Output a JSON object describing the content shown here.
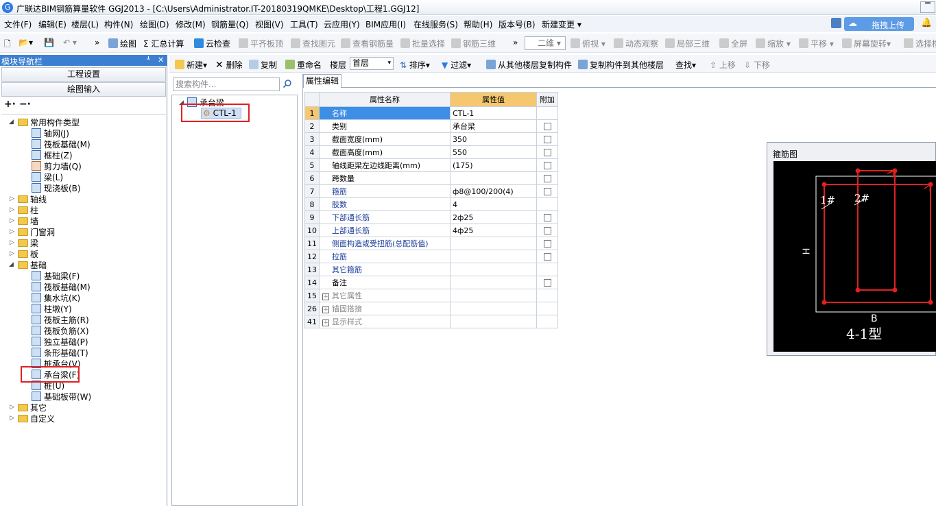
{
  "window": {
    "title": "广联达BIM钢筋算量软件 GGJ2013 - [C:\\Users\\Administrator.IT-20180319QMKE\\Desktop\\工程1.GGJ12]",
    "min": "▔",
    "close": "✕"
  },
  "menu": [
    "文件(F)",
    "编辑(E)",
    "楼层(L)",
    "构件(N)",
    "绘图(D)",
    "修改(M)",
    "钢筋量(Q)",
    "视图(V)",
    "工具(T)",
    "云应用(Y)",
    "BIM应用(I)",
    "在线服务(S)",
    "帮助(H)",
    "版本号(B)",
    "新建变更 ▾"
  ],
  "upload": {
    "label": "拖拽上传"
  },
  "toolbar": {
    "draw": "绘图",
    "sum": "Σ 汇总计算",
    "cloud_check": "云检查",
    "flat": "平齐板顶",
    "find_elem": "查找图元",
    "view_rebar": "查看钢筋量",
    "batch_select": "批量选择",
    "rebar3d": "钢筋三维",
    "dim": "二维",
    "top_view": "俯视",
    "dynamic": "动态观察",
    "local3d": "局部三维",
    "full": "全屏",
    "zoom": "缩放",
    "pan": "平移",
    "rotate": "屏幕旋转",
    "select": "选择楼"
  },
  "nav": {
    "title": "模块导航栏",
    "pin": "ᚆ",
    "close": "✕",
    "project_settings": "工程设置",
    "drawing_input": "绘图输入",
    "expand": "⁺",
    "collapse": "⁻"
  },
  "tree": {
    "common": "常用构件类型",
    "common_items": [
      "轴网(J)",
      "筏板基础(M)",
      "框柱(Z)",
      "剪力墙(Q)",
      "梁(L)",
      "现浇板(B)"
    ],
    "groups": [
      "轴线",
      "柱",
      "墙",
      "门窗洞",
      "梁",
      "板"
    ],
    "foundation": "基础",
    "foundation_items": [
      "基础梁(F)",
      "筏板基础(M)",
      "集水坑(K)",
      "柱墩(Y)",
      "筏板主筋(R)",
      "筏板负筋(X)",
      "独立基础(P)",
      "条形基础(T)",
      "桩承台(V)",
      "承台梁(F)",
      "桩(U)",
      "基础板带(W)"
    ],
    "others": [
      "其它",
      "自定义"
    ]
  },
  "maintoolbar": {
    "new": "新建▾",
    "delete": "删除",
    "copy": "复制",
    "rename": "重命名",
    "floor_label": "楼层",
    "floor_value": "首层",
    "sort": "排序▾",
    "filter": "过滤▾",
    "copy_from": "从其他楼层复制构件",
    "copy_to": "复制构件到其他楼层",
    "find": "查找▾",
    "up": "上移",
    "down": "下移"
  },
  "search": {
    "placeholder": "搜索构件..."
  },
  "component_tree": {
    "root": "承台梁",
    "item": "CTL-1"
  },
  "tab": "属性编辑",
  "grid": {
    "headers": [
      "属性名称",
      "属性值",
      "附加"
    ],
    "rows": [
      {
        "n": "1",
        "name": "名称",
        "value": "CTL-1",
        "check": false
      },
      {
        "n": "2",
        "name": "类别",
        "value": "承台梁",
        "check": true
      },
      {
        "n": "3",
        "name": "截面宽度(mm)",
        "value": "350",
        "check": true
      },
      {
        "n": "4",
        "name": "截面高度(mm)",
        "value": "550",
        "check": true
      },
      {
        "n": "5",
        "name": "轴线距梁左边线距离(mm)",
        "value": "(175)",
        "check": true
      },
      {
        "n": "6",
        "name": "跨数量",
        "value": "",
        "check": true
      },
      {
        "n": "7",
        "name": "箍筋",
        "value": "ф8@100/200(4)",
        "check": true
      },
      {
        "n": "8",
        "name": "肢数",
        "value": "4",
        "check": false
      },
      {
        "n": "9",
        "name": "下部通长筋",
        "value": "2ф25",
        "check": true
      },
      {
        "n": "10",
        "name": "上部通长筋",
        "value": "4ф25",
        "check": true
      },
      {
        "n": "11",
        "name": "侧面构造或受扭筋(总配筋值)",
        "value": "",
        "check": true
      },
      {
        "n": "12",
        "name": "拉筋",
        "value": "",
        "check": true
      },
      {
        "n": "13",
        "name": "其它箍筋",
        "value": "",
        "check": false
      },
      {
        "n": "14",
        "name": "备注",
        "value": "",
        "check": true
      }
    ],
    "groups": [
      {
        "n": "15",
        "name": "其它属性"
      },
      {
        "n": "26",
        "name": "锚固搭接"
      },
      {
        "n": "41",
        "name": "显示样式"
      }
    ]
  },
  "stirrup": {
    "caption": "箍筋图",
    "label1": "1#",
    "label2": "2#",
    "h": "H",
    "b": "B",
    "type": "4-1型"
  }
}
